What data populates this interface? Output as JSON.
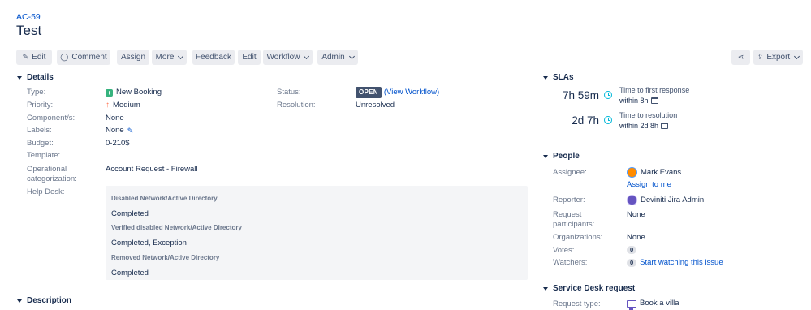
{
  "issue": {
    "key": "AC-59",
    "title": "Test"
  },
  "toolbar": {
    "edit": "Edit",
    "comment": "Comment",
    "assign": "Assign",
    "more": "More",
    "feedback": "Feedback",
    "edit2": "Edit",
    "workflow": "Workflow",
    "admin": "Admin",
    "export": "Export"
  },
  "details": {
    "heading": "Details",
    "type_label": "Type:",
    "type_value": "New Booking",
    "priority_label": "Priority:",
    "priority_value": "Medium",
    "components_label": "Component/s:",
    "components_value": "None",
    "labels_label": "Labels:",
    "labels_value": "None",
    "budget_label": "Budget:",
    "budget_value": "0-210$",
    "template_label": "Template:",
    "opcat_label_1": "Operational",
    "opcat_label_2": "categorization:",
    "opcat_value": "Account Request - Firewall",
    "helpdesk_label": "Help Desk:",
    "status_label": "Status:",
    "status_value": "OPEN",
    "view_workflow": "(View Workflow)",
    "resolution_label": "Resolution:",
    "resolution_value": "Unresolved"
  },
  "helpdesk": [
    {
      "label": "Disabled Network/Active Directory",
      "value": "Completed"
    },
    {
      "label": "Verified disabled Network/Active Directory",
      "value": "Completed, Exception"
    },
    {
      "label": "Removed Network/Active Directory",
      "value": "Completed"
    }
  ],
  "description": {
    "heading": "Description"
  },
  "slas": {
    "heading": "SLAs",
    "items": [
      {
        "time": "7h 59m",
        "name": "Time to first response",
        "goal": "within 8h"
      },
      {
        "time": "2d 7h",
        "name": "Time to resolution",
        "goal": "within 2d 8h"
      }
    ]
  },
  "people": {
    "heading": "People",
    "assignee_label": "Assignee:",
    "assignee_value": "Mark Evans",
    "assign_to_me": "Assign to me",
    "reporter_label": "Reporter:",
    "reporter_value": "Deviniti Jira Admin",
    "participants_label_1": "Request",
    "participants_label_2": "participants:",
    "participants_value": "None",
    "organizations_label": "Organizations:",
    "organizations_value": "None",
    "votes_label": "Votes:",
    "votes_value": "0",
    "watchers_label": "Watchers:",
    "watchers_value": "0",
    "start_watching": "Start watching this issue"
  },
  "service_desk": {
    "heading": "Service Desk request",
    "request_type_label": "Request type:",
    "request_type_value": "Book a villa"
  },
  "colors": {
    "link": "#0052cc",
    "open_lozenge": "#42526e",
    "sla_clock": "#00b8d9"
  }
}
